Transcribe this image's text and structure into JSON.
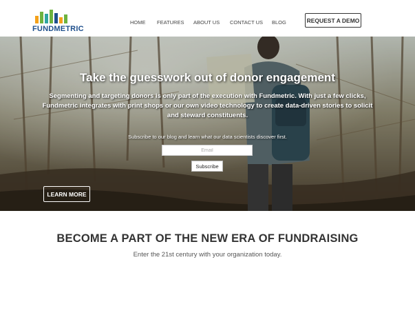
{
  "header": {
    "logo_text": "FUNDMETRIC",
    "nav": [
      "HOME",
      "FEATURES",
      "ABOUT US",
      "CONTACT US",
      "BLOG"
    ],
    "demo_label": "REQUEST A DEMO"
  },
  "hero": {
    "title": "Take the guesswork out of donor engagement",
    "subtitle": "Segmenting and targeting donors is only part of the execution with Fundmetric. With just a few clicks, Fundmetric integrates with print shops or our own video technology to create data-driven stories to solicit and steward constituents.",
    "prompt": "Subscribe to our blog and learn what our data scientists discover first.",
    "email_placeholder": "Email",
    "subscribe_label": "Subscribe",
    "learn_more_label": "LEARN MORE"
  },
  "section": {
    "title": "BECOME A PART OF THE NEW ERA OF FUNDRAISING",
    "subtitle": "Enter the 21st century with your organization today."
  },
  "colors": {
    "logo_blue": "#1e4f8c",
    "logo_green": "#6db33f",
    "logo_orange": "#f4a11a",
    "logo_teal": "#2fa4a0"
  }
}
